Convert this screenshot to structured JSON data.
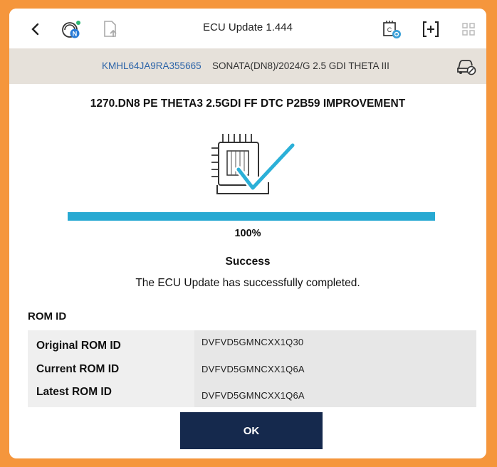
{
  "header": {
    "title": "ECU Update 1.444",
    "icons": [
      "back-chevron-icon",
      "network-n-icon",
      "document-upload-icon",
      "ecu-mode-icon",
      "add-bracket-icon",
      "grid-icon"
    ],
    "accent_green": "#2bb673"
  },
  "vehicle": {
    "vin": "KMHL64JA9RA355665",
    "model": "SONATA(DN8)/2024/G 2.5 GDI THETA III",
    "icon": "car-settings-icon"
  },
  "update": {
    "heading": "1270.DN8 PE THETA3 2.5GDI FF DTC P2B59 IMPROVEMENT",
    "illustration": "ecu-checkmark-icon",
    "progress_percent": 100,
    "progress_label": "100%",
    "status": "Success",
    "message": "The ECU Update has successfully completed.",
    "progress_color": "#27a9d2"
  },
  "rom": {
    "title": "ROM ID",
    "rows": [
      {
        "label": "Original ROM ID",
        "value": "DVFVD5GMNCXX1Q30"
      },
      {
        "label": "Current ROM ID",
        "value": "DVFVD5GMNCXX1Q6A"
      },
      {
        "label": "Latest ROM ID",
        "value": "DVFVD5GMNCXX1Q6A"
      }
    ]
  },
  "actions": {
    "ok_label": "OK",
    "ok_color": "#15294d"
  },
  "frame_color": "#f5963c"
}
